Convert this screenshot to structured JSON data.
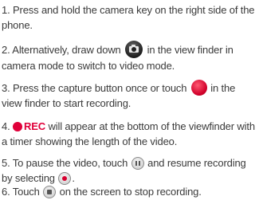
{
  "steps": [
    {
      "num": "1.",
      "text": "Press and hold the camera key on the right side of the phone."
    },
    {
      "num": "2.",
      "text_a": "Alternatively, draw down",
      "text_b": "in the view finder in camera mode to switch to video mode."
    },
    {
      "num": "3.",
      "text_a": "Press the capture button once or touch",
      "text_b": "in the view finder to start recording."
    },
    {
      "num": "4.",
      "rec_label": "REC",
      "text_b": "will appear at the bottom of the viewfinder with a timer showing the length of the video."
    },
    {
      "num": "5.",
      "text_a": "To pause the video, touch",
      "text_b": "and resume recording by selecting",
      "text_c": "."
    },
    {
      "num": "6.",
      "text_a": "Touch",
      "text_b": "on the screen to stop recording."
    }
  ],
  "icons": {
    "camera_toggle": "camera-toggle-icon",
    "record": "record-icon",
    "rec_indicator": "rec-dot-icon",
    "pause": "pause-icon",
    "resume": "resume-record-icon",
    "stop": "stop-icon"
  },
  "colors": {
    "text": "#3a3a3a",
    "rec_red": "#e0003a"
  }
}
